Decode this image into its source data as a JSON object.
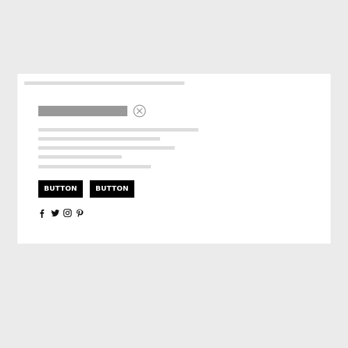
{
  "buttons": {
    "primary_label": "BUTTON",
    "secondary_label": "BUTTON"
  },
  "icons": {
    "close": "close-circle-x-icon",
    "social": [
      "facebook-icon",
      "twitter-icon",
      "instagram-icon",
      "pinterest-icon"
    ]
  },
  "colors": {
    "background": "#ebebeb",
    "card": "#ffffff",
    "placeholder_line": "#dddddd",
    "title_placeholder": "#999999",
    "button": "#000000",
    "button_text": "#ffffff"
  }
}
